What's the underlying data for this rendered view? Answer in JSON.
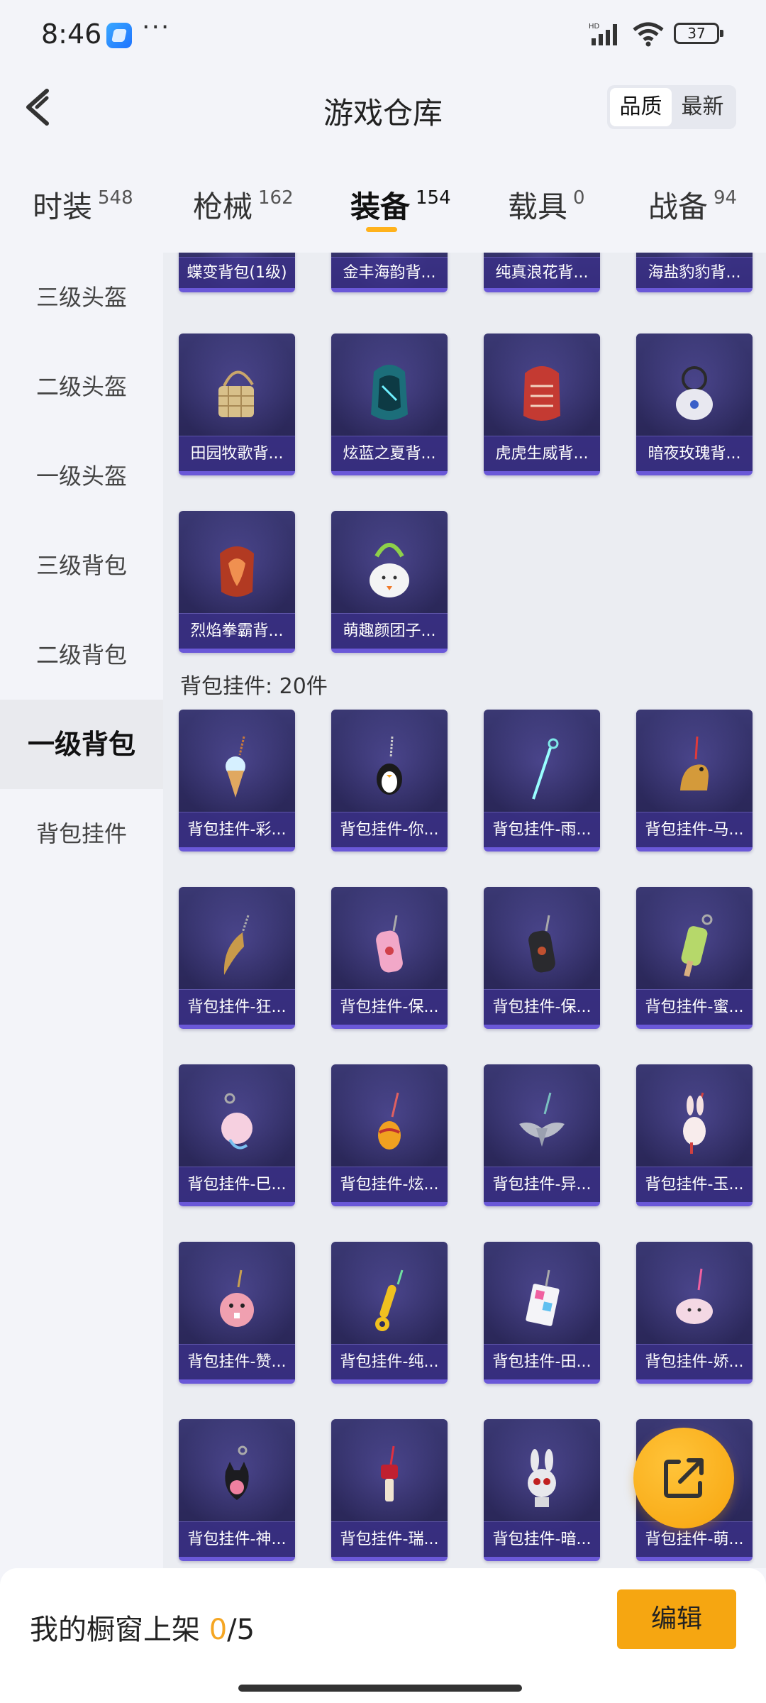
{
  "status_bar": {
    "time": "8:46",
    "more": "···",
    "battery": "37"
  },
  "header": {
    "title": "游戏仓库",
    "sort_options": [
      "品质",
      "最新"
    ],
    "sort_active": "品质"
  },
  "tabs": [
    {
      "label": "时装",
      "count": "548"
    },
    {
      "label": "枪械",
      "count": "162"
    },
    {
      "label": "装备",
      "count": "154"
    },
    {
      "label": "载具",
      "count": "0"
    },
    {
      "label": "战备",
      "count": "94"
    }
  ],
  "active_tab": "装备",
  "sidebar": [
    {
      "label": "三级头盔"
    },
    {
      "label": "二级头盔"
    },
    {
      "label": "一级头盔"
    },
    {
      "label": "三级背包"
    },
    {
      "label": "二级背包"
    },
    {
      "label": "一级背包"
    },
    {
      "label": "背包挂件"
    }
  ],
  "sidebar_active": "一级背包",
  "backpacks": {
    "row_cut": [
      "蝶变背包(1级)",
      "金丰海韵背...",
      "纯真浪花背...",
      "海盐豹豹背..."
    ],
    "row_2": [
      "田园牧歌背...",
      "炫蓝之夏背...",
      "虎虎生威背...",
      "暗夜玫瑰背..."
    ],
    "row_3": [
      "烈焰拳霸背...",
      "萌趣颜团子..."
    ]
  },
  "pendants": {
    "section_title": "背包挂件: 20件",
    "items": [
      "背包挂件-彩...",
      "背包挂件-你...",
      "背包挂件-雨...",
      "背包挂件-马...",
      "背包挂件-狂...",
      "背包挂件-保...",
      "背包挂件-保...",
      "背包挂件-蜜...",
      "背包挂件-巳...",
      "背包挂件-炫...",
      "背包挂件-异...",
      "背包挂件-玉...",
      "背包挂件-赞...",
      "背包挂件-纯...",
      "背包挂件-田...",
      "背包挂件-娇...",
      "背包挂件-神...",
      "背包挂件-瑞...",
      "背包挂件-暗...",
      "背包挂件-萌..."
    ]
  },
  "bottom_bar": {
    "label": "我的橱窗上架 ",
    "current": "0",
    "total": "/5",
    "edit": "编辑"
  },
  "colors": {
    "accent": "#f6a611",
    "card_bg": "#2d2a5e",
    "card_border": "#6a58d8"
  }
}
